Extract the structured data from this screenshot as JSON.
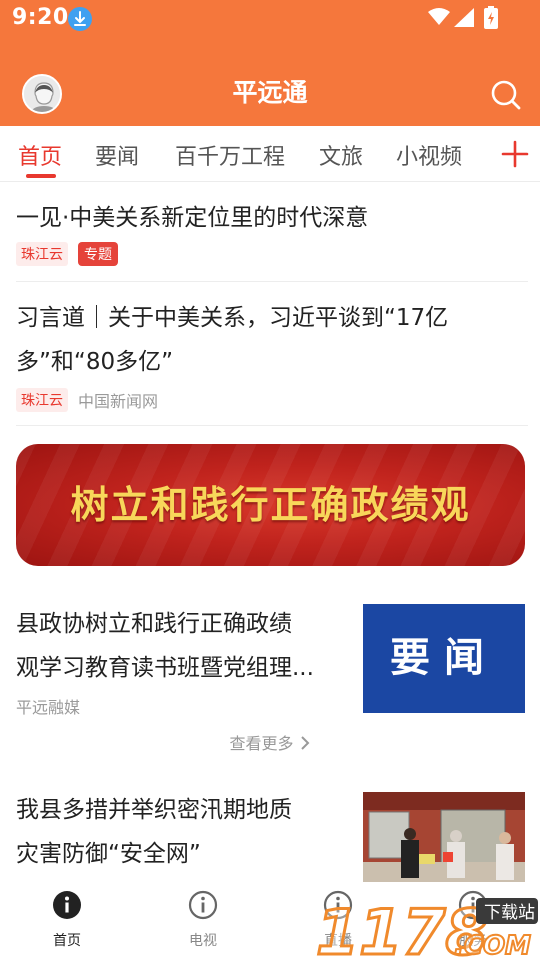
{
  "status_bar": {
    "time": "9:20"
  },
  "header": {
    "title": "平远通"
  },
  "tabs": [
    {
      "label": "首页"
    },
    {
      "label": "要闻"
    },
    {
      "label": "百千万工程"
    },
    {
      "label": "文旅"
    },
    {
      "label": "小视频"
    }
  ],
  "feed": {
    "items": [
      {
        "title": "一见·中美关系新定位里的时代深意",
        "source_tag": "珠江云",
        "topic_tag": "专题"
      },
      {
        "title_line1": "习言道｜关于中美关系，习近平谈到“17亿",
        "title_line2": "多”和“80多亿”",
        "source_tag": "珠江云",
        "source": "中国新闻网"
      },
      {
        "title_line1": "县政协树立和践行正确政绩",
        "title_line2": "观学习教育读书班暨党组理...",
        "source": "平远融媒"
      },
      {
        "title_line1": "我县多措并举织密汛期地质",
        "title_line2": "灾害防御“安全网”"
      }
    ],
    "banner_text": "树立和践行正确政绩观",
    "thumb_news_text": "要闻",
    "more_label": "查看更多"
  },
  "bottom_nav": [
    {
      "label": "首页",
      "icon": "info-circle-icon",
      "active": true
    },
    {
      "label": "电视",
      "icon": "info-circle-icon"
    },
    {
      "label": "直播",
      "icon": "info-circle-icon"
    },
    {
      "label": "服务",
      "icon": "info-circle-icon"
    }
  ],
  "watermark": {
    "main": "1178",
    "suffix": ".COM",
    "badge": "下载站"
  },
  "colors": {
    "brand_orange": "#f5773c",
    "accent_red": "#e8382e"
  }
}
